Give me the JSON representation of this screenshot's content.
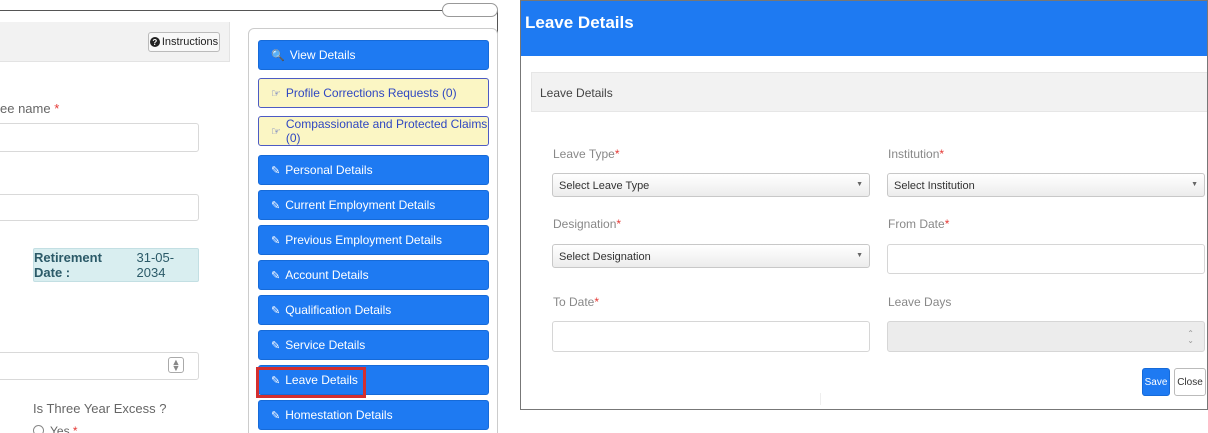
{
  "left": {
    "instructions_label": "Instructions",
    "employee_name_label": "ee name",
    "required_star": "*",
    "retirement_label": "Retirement Date :",
    "retirement_value": "31-05-2034",
    "three_year_label": "Is Three Year Excess ?",
    "radio_yes": "Yes"
  },
  "sidebar": {
    "items": [
      {
        "label": "View Details",
        "icon": "search-icon",
        "glyph": "🔍"
      },
      {
        "label": "Profile Corrections Requests (0)",
        "icon": "hand-point-icon",
        "glyph": "☞"
      },
      {
        "label": "Compassionate and Protected Claims (0)",
        "icon": "hand-point-icon",
        "glyph": "☞"
      },
      {
        "label": "Personal Details",
        "icon": "pencil-icon",
        "glyph": "✎"
      },
      {
        "label": "Current Employment Details",
        "icon": "pencil-icon",
        "glyph": "✎"
      },
      {
        "label": "Previous Employment Details",
        "icon": "pencil-icon",
        "glyph": "✎"
      },
      {
        "label": "Account Details",
        "icon": "pencil-icon",
        "glyph": "✎"
      },
      {
        "label": "Qualification Details",
        "icon": "pencil-icon",
        "glyph": "✎"
      },
      {
        "label": "Service Details",
        "icon": "pencil-icon",
        "glyph": "✎"
      },
      {
        "label": "Leave Details",
        "icon": "pencil-icon",
        "glyph": "✎"
      },
      {
        "label": "Homestation Details",
        "icon": "pencil-icon",
        "glyph": "✎"
      }
    ]
  },
  "modal": {
    "title": "Leave Details",
    "panel_title": "Leave Details",
    "leave_type_label": "Leave Type",
    "leave_type_value": "Select Leave Type",
    "institution_label": "Institution",
    "institution_value": "Select Institution",
    "designation_label": "Designation",
    "designation_value": "Select Designation",
    "from_date_label": "From Date",
    "to_date_label": "To Date",
    "leave_days_label": "Leave Days",
    "save_label": "Save",
    "close_label": "Close",
    "required_star": "*"
  },
  "colors": {
    "primary": "#1e7af2",
    "highlight": "#d32f2f",
    "notice_bg": "#fbf6c4",
    "retire_bg": "#d9eef0"
  }
}
